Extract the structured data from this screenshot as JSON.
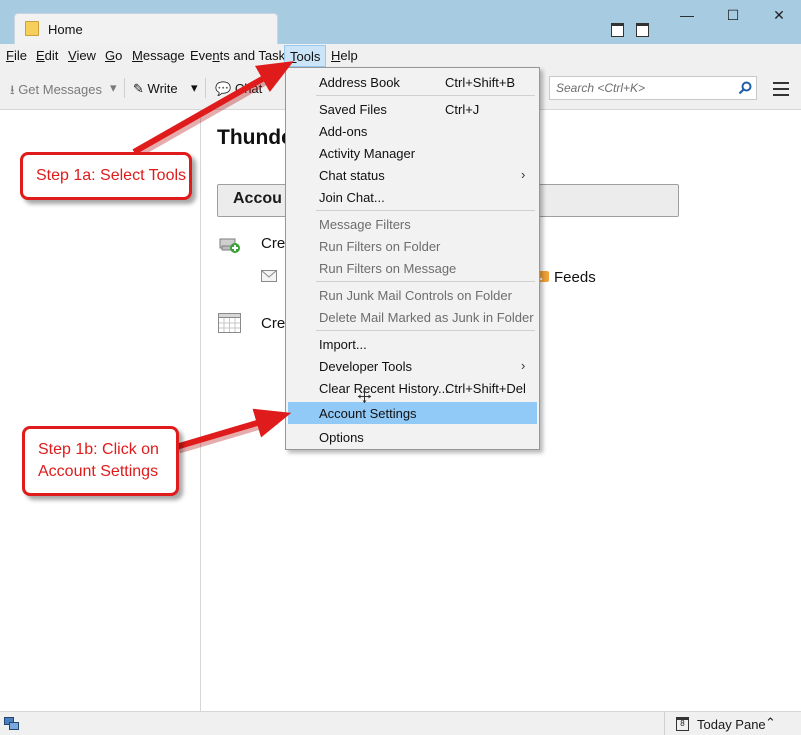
{
  "window": {
    "tab_title": "Home",
    "controls": {
      "minimize": "—",
      "maximize": "☐",
      "close": "✕"
    }
  },
  "menubar": [
    {
      "text": "File",
      "u": "F"
    },
    {
      "text": "Edit",
      "u": "E"
    },
    {
      "text": "View",
      "u": "V"
    },
    {
      "text": "Go",
      "u": "G"
    },
    {
      "text": "Message",
      "u": "M"
    },
    {
      "text": "Events and Tasks",
      "u": "n"
    },
    {
      "text": "Tools",
      "u": "T"
    },
    {
      "text": "Help",
      "u": "H"
    }
  ],
  "toolbar": {
    "get_messages": "Get Messages",
    "write": "Write",
    "chat": "Chat",
    "search_placeholder": "Search <Ctrl+K>"
  },
  "content": {
    "title": "Thunde",
    "accounts_heading": "Accou",
    "create_row_1": "Cre",
    "feeds": "Feeds",
    "create_row_2": "Cre"
  },
  "tools_menu": {
    "items": [
      {
        "label": "Address Book",
        "shortcut": "Ctrl+Shift+B"
      },
      {
        "label": "Saved Files",
        "shortcut": "Ctrl+J"
      },
      {
        "label": "Add-ons"
      },
      {
        "label": "Activity Manager"
      },
      {
        "label": "Chat status"
      },
      {
        "label": "Join Chat..."
      },
      {
        "label": "Message Filters"
      },
      {
        "label": "Run Filters on Folder"
      },
      {
        "label": "Run Filters on Message"
      },
      {
        "label": "Run Junk Mail Controls on Folder"
      },
      {
        "label": "Delete Mail Marked as Junk in Folder"
      },
      {
        "label": "Import..."
      },
      {
        "label": "Developer Tools"
      },
      {
        "label": "Clear Recent History...",
        "shortcut": "Ctrl+Shift+Del"
      },
      {
        "label": "Account Settings"
      },
      {
        "label": "Options"
      }
    ]
  },
  "callouts": {
    "step1a": "Step 1a: Select Tools",
    "step1b": "Step 1b: Click on\nAccount Settings"
  },
  "statusbar": {
    "today_pane": "Today Pane",
    "today_date": "8"
  },
  "colors": {
    "titlebar": "#a7cbe0",
    "menu_highlight": "#91c9f7",
    "callout_red": "#e01b1b"
  }
}
